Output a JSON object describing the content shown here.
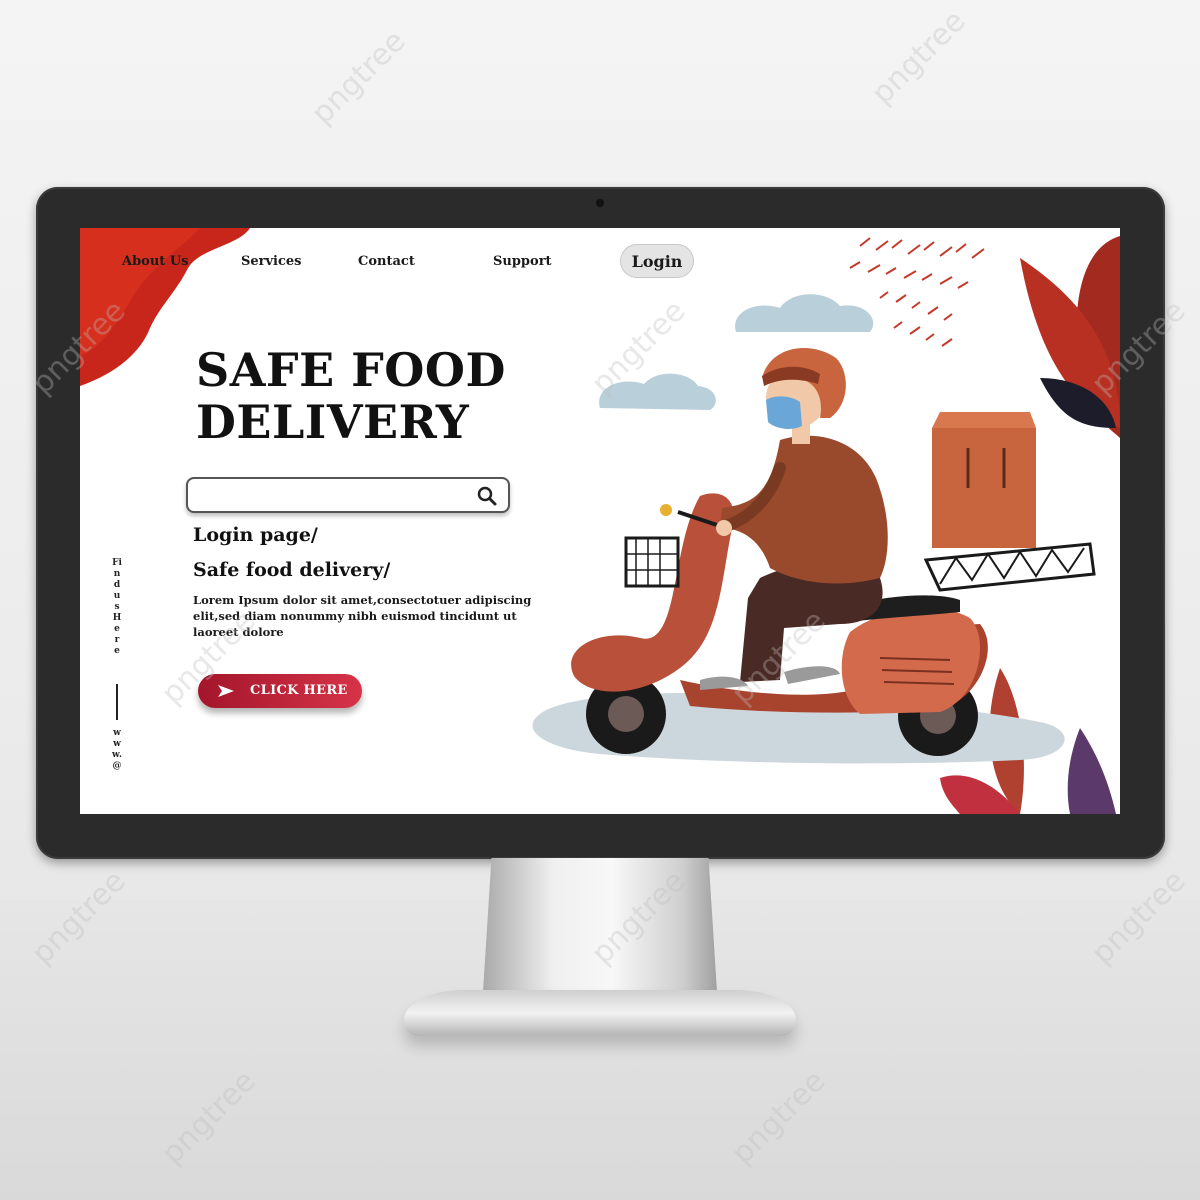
{
  "nav": {
    "items": [
      {
        "label": "About Us"
      },
      {
        "label": "Services"
      },
      {
        "label": "Contact"
      },
      {
        "label": "Support"
      }
    ],
    "login_label": "Login"
  },
  "hero": {
    "title": "SAFE FOOD DELIVERY",
    "subtitle_1": "Login page/",
    "subtitle_2": "Safe food delivery/",
    "body": "Lorem Ipsum dolor sit amet,consectotuer adipiscing elit,sed diam nonummy nibh euismod tincidunt ut laoreet dolore",
    "cta_label": "CLICK HERE"
  },
  "search": {
    "value": "",
    "placeholder": ""
  },
  "sidebar": {
    "find_text": "Find us Here",
    "web_text": "www.@"
  },
  "watermark": "pngtree",
  "colors": {
    "accent_red": "#c8261b",
    "cta_start": "#a3162b",
    "cta_end": "#d63348",
    "bezel": "#2b2b2b",
    "scooter": "#b8503a",
    "jacket": "#9a4a2c",
    "box": "#c8653e"
  },
  "icons": [
    "search-icon",
    "arrow-right-icon"
  ]
}
